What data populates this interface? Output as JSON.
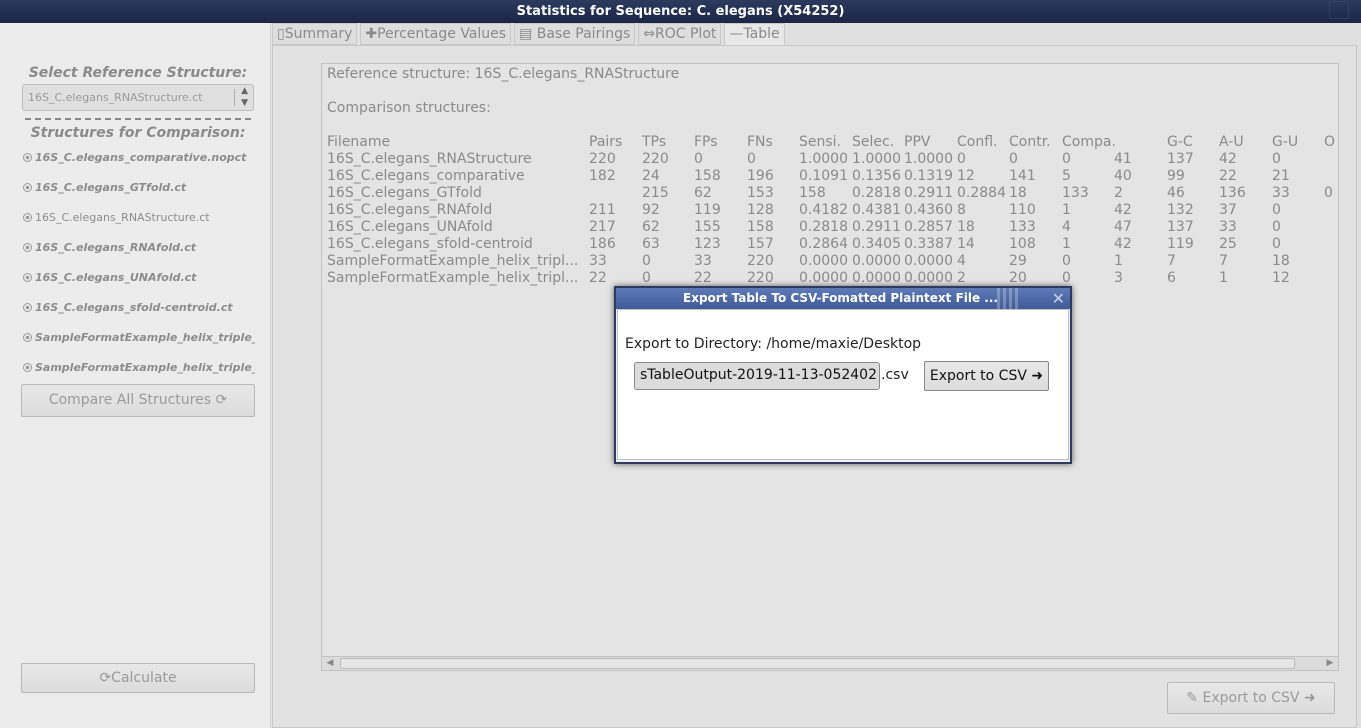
{
  "window": {
    "title": "Statistics for Sequence: C. elegans (X54252)"
  },
  "left_panel": {
    "reference_header": "Select Reference Structure:",
    "reference_selected": "16S_C.elegans_RNAStructure.ct",
    "comparison_header": "Structures for Comparison:",
    "structures": [
      "16S_C.elegans_comparative.nopct",
      "16S_C.elegans_GTfold.ct",
      "16S_C.elegans_RNAStructure.ct",
      "16S_C.elegans_RNAfold.ct",
      "16S_C.elegans_UNAfold.ct",
      "16S_C.elegans_sfold-centroid.ct",
      "SampleFormatExample_helix_triple_form",
      "SampleFormatExample_helix_triple_form"
    ],
    "compare_button": "Compare All Structures",
    "calculate_button": "Calculate"
  },
  "tabs": [
    {
      "label": "Summary",
      "icon": "document-icon"
    },
    {
      "label": "Percentage Values",
      "icon": "plus-icon"
    },
    {
      "label": "Base Pairings",
      "icon": "stack-icon"
    },
    {
      "label": "ROC Plot",
      "icon": "diamond-arrows-icon"
    },
    {
      "label": "—Table",
      "icon": ""
    }
  ],
  "table_text": {
    "reference_line": "Reference structure: 16S_C.elegans_RNAStructure",
    "comparison_line": "Comparison structures:",
    "columns": [
      "Filename",
      "Pairs",
      "TPs",
      "FPs",
      "FNs",
      "Sensi.",
      "Selec.",
      "PPV",
      "Confl.",
      "Contr.",
      "Compa.",
      "G-C",
      "A-U",
      "G-U",
      "O"
    ],
    "rows": [
      [
        "16S_C.elegans_RNAStructure",
        "220",
        "220",
        "0",
        "0",
        "1.0000",
        "1.0000",
        "1.0000",
        "0",
        "0",
        "0",
        "41",
        "137",
        "42",
        "0"
      ],
      [
        "16S_C.elegans_comparative",
        "182",
        "24",
        "158",
        "196",
        "0.1091",
        "0.1356",
        "0.1319",
        "12",
        "141",
        "5",
        "40",
        "99",
        "22",
        "21"
      ],
      [
        "16S_C.elegans_GTfold",
        "",
        "215",
        "62",
        "153",
        "158",
        "0.2818",
        "0.2911",
        "0.2884",
        "18",
        "133",
        "2",
        "46",
        "136",
        "33",
        "0"
      ],
      [
        "16S_C.elegans_RNAfold",
        "211",
        "92",
        "119",
        "128",
        "0.4182",
        "0.4381",
        "0.4360",
        "8",
        "110",
        "1",
        "42",
        "132",
        "37",
        "0"
      ],
      [
        "16S_C.elegans_UNAfold",
        "217",
        "62",
        "155",
        "158",
        "0.2818",
        "0.2911",
        "0.2857",
        "18",
        "133",
        "4",
        "47",
        "137",
        "33",
        "0"
      ],
      [
        "16S_C.elegans_sfold-centroid",
        "186",
        "63",
        "123",
        "157",
        "0.2864",
        "0.3405",
        "0.3387",
        "14",
        "108",
        "1",
        "42",
        "119",
        "25",
        "0"
      ],
      [
        "SampleFormatExample_helix_tripl...",
        "33",
        "0",
        "33",
        "220",
        "0.0000",
        "0.0000",
        "0.0000",
        "4",
        "29",
        "0",
        "1",
        "7",
        "7",
        "18"
      ],
      [
        "SampleFormatExample_helix_tripl...",
        "22",
        "0",
        "22",
        "220",
        "0.0000",
        "0.0000",
        "0.0000",
        "2",
        "20",
        "0",
        "3",
        "6",
        "1",
        "12"
      ]
    ]
  },
  "export_button": "Export to CSV",
  "dialog": {
    "title": "Export Table To CSV-Fomatted Plaintext File ...",
    "directory_label": "Export to Directory: /home/maxie/Desktop",
    "filename_value": "sTableOutput-2019-11-13-052402",
    "extension": ".csv",
    "export_button": "Export to CSV"
  }
}
